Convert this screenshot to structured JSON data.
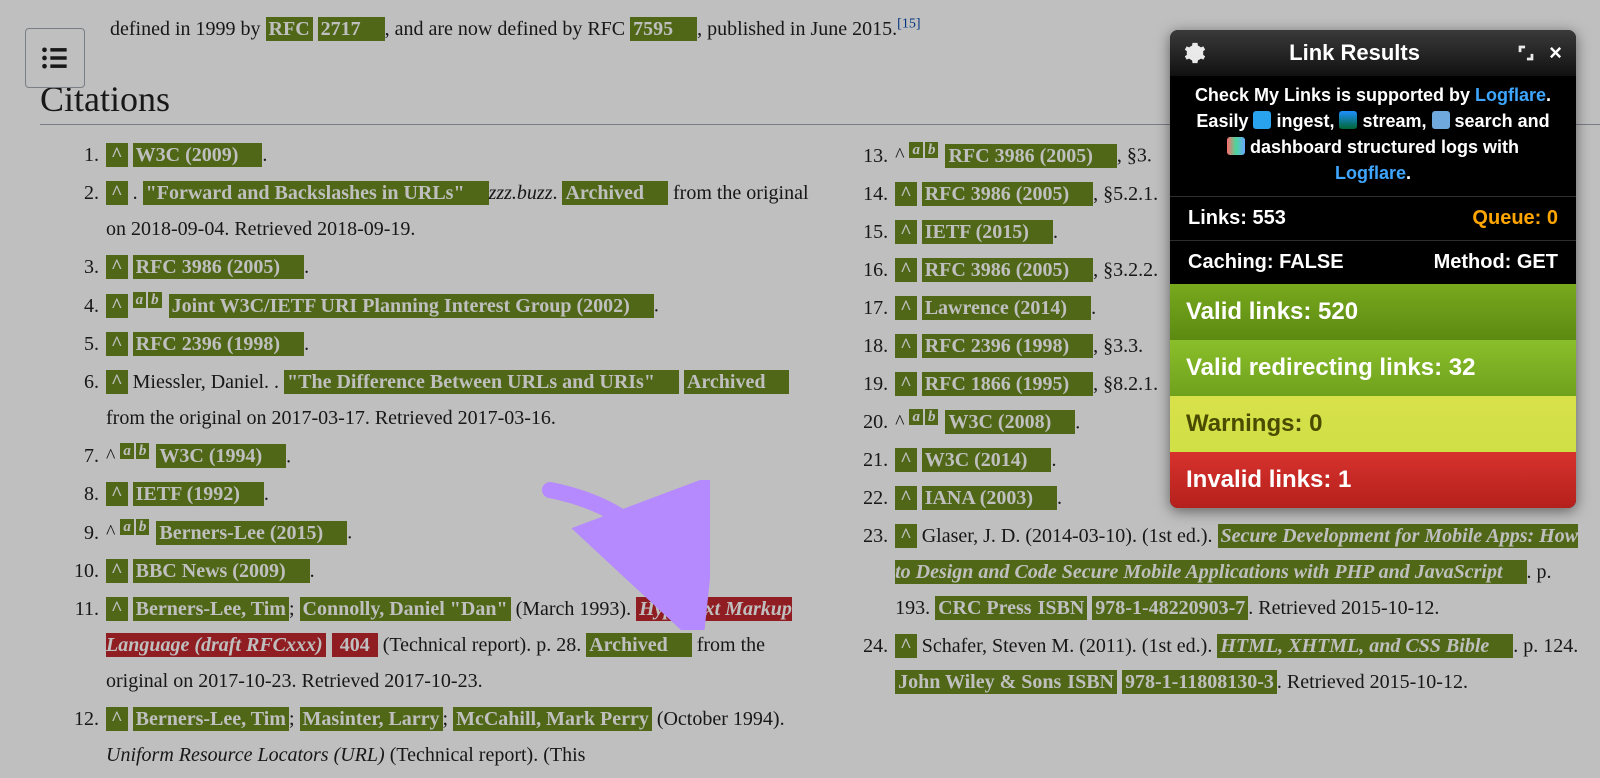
{
  "intro": {
    "pre": "defined in 1999 by ",
    "rfc1_lab": "RFC",
    "rfc1_num": "2717",
    "mid": ", and are now defined by RFC ",
    "rfc2_num": "7595",
    "post": ", published in June 2015.",
    "ref_sup": "[15]"
  },
  "section_title": "Citations",
  "col1_start": 1,
  "col2_start": 13,
  "col1": [
    {
      "caret": "^",
      "main": "W3C (2009)",
      "tail": "."
    },
    {
      "caret": "^",
      "main": "\"Forward and Backslashes in URLs\"",
      "mid": ". ",
      "ital": "zzz.buzz",
      "mid2": ". ",
      "arch": "Archived",
      "tail": " from the original on 2018-09-04. Retrieved 2018-09-19."
    },
    {
      "caret": "^",
      "main": "RFC 3986 (2005)",
      "tail": "."
    },
    {
      "caret": "^",
      "sup_ab": true,
      "main": "Joint W3C/IETF URI Planning Interest Group (2002)",
      "tail": "."
    },
    {
      "caret": "^",
      "main": "RFC 2396 (1998)",
      "tail": "."
    },
    {
      "caret": "^",
      "plain": "Miessler, Daniel. ",
      "main": "\"The Difference Between URLs and URIs\"",
      "mid": ". ",
      "arch": "Archived",
      "tail": " from the original on 2017-03-17. Retrieved 2017-03-16."
    },
    {
      "caret_plain": "^",
      "sup_ab": true,
      "main": "W3C (1994)",
      "tail": "."
    },
    {
      "caret": "^",
      "main": "IETF (1992)",
      "tail": "."
    },
    {
      "caret_plain": "^",
      "sup_ab": true,
      "main": "Berners-Lee (2015)",
      "tail": "."
    },
    {
      "caret": "^",
      "main": "BBC News (2009)",
      "tail": "."
    },
    {
      "caret": "^",
      "a1": "Berners-Lee, Tim",
      "sep1": "; ",
      "a2": "Connolly, Daniel \"Dan\"",
      "mid": " (March 1993). ",
      "bad": "Hypertext Markup Language (draft RFCxxx)",
      "bad404": "404",
      "mid2": " (Technical report). p. 28. ",
      "arch": "Archived",
      "tail": " from the original on 2017-10-23. Retrieved 2017-10-23."
    },
    {
      "caret": "^",
      "a1": "Berners-Lee, Tim",
      "sep1": "; ",
      "a2": "Masinter, Larry",
      "sep2": "; ",
      "a3": "McCahill, Mark Perry",
      "mid": " (October 1994). ",
      "ital": "Uniform Resource Locators (URL)",
      "tail": " (Technical report). (This"
    }
  ],
  "col2": [
    {
      "caret_plain": "^",
      "sup_ab": true,
      "main": "RFC 3986 (2005)",
      "tail": ", §3."
    },
    {
      "caret": "^",
      "main": "RFC 3986 (2005)",
      "tail": ", §5.2.1."
    },
    {
      "caret": "^",
      "main": "IETF (2015)",
      "tail": "."
    },
    {
      "caret": "^",
      "main": "RFC 3986 (2005)",
      "tail": ", §3.2.2."
    },
    {
      "caret": "^",
      "main": "Lawrence (2014)",
      "tail": "."
    },
    {
      "caret": "^",
      "main": "RFC 2396 (1998)",
      "tail": ", §3.3."
    },
    {
      "caret": "^",
      "main": "RFC 1866 (1995)",
      "tail": ", §8.2.1."
    },
    {
      "caret_plain": "^",
      "sup_ab": true,
      "main": "W3C (2008)",
      "tail": "."
    },
    {
      "caret": "^",
      "main": "W3C (2014)",
      "tail": "."
    },
    {
      "caret": "^",
      "main": "IANA (2003)",
      "tail": "."
    },
    {
      "caret": "^",
      "plain": "Glaser, J. D. (2014-03-10). ",
      "ital_hl": "Secure Development for Mobile Apps: How to Design and Code Secure Mobile Applications with PHP and JavaScript",
      "mid": " (1st ed.). ",
      "pub": "CRC Press",
      "mid2": ". p. 193. ",
      "isbn_lab": "ISBN",
      "isbn": "978-1-48220903-7",
      "tail": ". Retrieved 2015-10-12."
    },
    {
      "caret": "^",
      "plain": "Schafer, Steven M. (2011). ",
      "ital_hl": "HTML, XHTML, and CSS Bible",
      "mid": " (1st ed.). ",
      "pub": "John Wiley & Sons",
      "mid2": ". p. 124. ",
      "isbn_lab": "ISBN",
      "isbn": "978-1-11808130-3",
      "tail": ". Retrieved 2015-10-12."
    }
  ],
  "panel": {
    "title": "Link Results",
    "promo_pre": "Check My Links is supported by ",
    "promo_lf1": "Logflare",
    "promo_mid": ". Easily ",
    "promo_w1": " ingest, ",
    "promo_w2": " stream, ",
    "promo_w3": " search and ",
    "promo_w4": " dashboard structured logs with ",
    "promo_lf2": "Logflare",
    "promo_end": ".",
    "links_label": "Links: ",
    "links_value": "553",
    "queue_label": "Queue: ",
    "queue_value": "0",
    "caching_label": "Caching: ",
    "caching_value": "FALSE",
    "method_label": "Method: ",
    "method_value": "GET",
    "valid_label": "Valid links: ",
    "valid_value": "520",
    "redir_label": "Valid redirecting links: ",
    "redir_value": "32",
    "warn_label": "Warnings: ",
    "warn_value": "0",
    "inval_label": "Invalid links: ",
    "inval_value": "1"
  }
}
